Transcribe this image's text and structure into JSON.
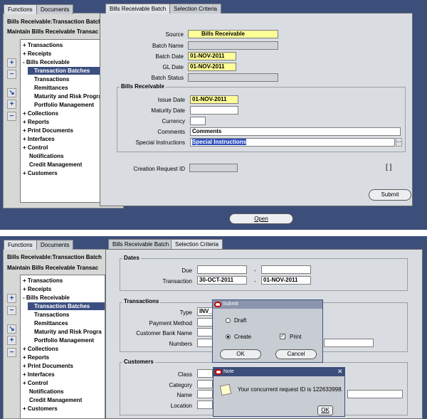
{
  "top": {
    "nav_tabs": [
      "Functions",
      "Documents"
    ],
    "nav_title_1": "Bills Receivable:Transaction Batch",
    "nav_title_2": "Maintain Bills Receivable Transac",
    "tree": [
      "+ Transactions",
      "+ Receipts",
      "- Bills Receivable",
      "Transaction Batches",
      "Transactions",
      "Remittances",
      "Maturity and Risk Progra",
      "Portfolio Management",
      "+ Collections",
      "+ Reports",
      "+ Print Documents",
      "+ Interfaces",
      "+ Control",
      "Notifications",
      "Credit Management",
      "+ Customers"
    ],
    "form_tabs": [
      "Bills Receivable Batch",
      "Selection Criteria"
    ],
    "source_label": "Source",
    "source_value": "Bills Receivable",
    "batch_name_label": "Batch Name",
    "batch_date_label": "Batch Date",
    "batch_date_value": "01-NOV-2011",
    "gl_date_label": "GL Date",
    "gl_date_value": "01-NOV-2011",
    "batch_status_label": "Batch Status",
    "group_title": "Bills Receivable",
    "issue_date_label": "Issue Date",
    "issue_date_value": "01-NOV-2011",
    "maturity_label": "Maturity Date",
    "currency_label": "Currency",
    "comments_label": "Comments",
    "comments_value": "Comments",
    "special_label": "Special Instructions",
    "special_value": "Special Instructions",
    "creation_label": "Creation Request ID",
    "bracket": "[ ]",
    "submit_button": "Submit",
    "open_button": "Open"
  },
  "bottom": {
    "nav_tabs": [
      "Functions",
      "Documents"
    ],
    "nav_title_1": "Bills Receivable:Transaction Batch",
    "nav_title_2": "Maintain Bills Receivable Transac",
    "form_tabs": [
      "Bills Receivable Batch",
      "Selection Criteria"
    ],
    "dates_title": "Dates",
    "due_label": "Due",
    "transaction_label": "Transaction",
    "transaction_from": "30-OCT-2011",
    "transaction_to": "01-NOV-2011",
    "dash": "-",
    "transactions_title": "Transactions",
    "type_label": "Type",
    "type_value": "INV_",
    "payment_label": "Payment Method",
    "bank_label": "Customer Bank Name",
    "numbers_label": "Numbers",
    "customers_title": "Customers",
    "class_label": "Class",
    "category_label": "Category",
    "name_label": "Name",
    "location_label": "Location",
    "submit_dialog": {
      "title": "Submit",
      "draft": "Draft",
      "create": "Create",
      "print": "Print",
      "ok": "OK",
      "cancel": "Cancel"
    },
    "note_dialog": {
      "title": "Note",
      "message": "Your concurrent request ID is 122633998.",
      "ok": "OK"
    }
  }
}
